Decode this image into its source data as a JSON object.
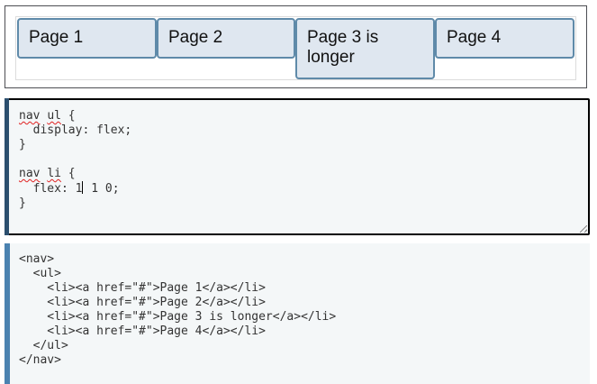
{
  "nav": {
    "items": [
      {
        "label": "Page 1",
        "href": "#"
      },
      {
        "label": "Page 2",
        "href": "#"
      },
      {
        "label": "Page 3 is longer",
        "href": "#"
      },
      {
        "label": "Page 4",
        "href": "#"
      }
    ]
  },
  "css_editor": {
    "rule1_selector_a": "nav",
    "rule1_selector_b": "ul",
    "rule1_open": " {",
    "rule1_decl": "  display: flex;",
    "rule1_close": "}",
    "rule2_selector_a": "nav",
    "rule2_selector_b": "li",
    "rule2_open": " {",
    "rule2_decl_before_caret": "  flex: 1",
    "rule2_decl_after_caret": " 1 0;",
    "rule2_close": "}"
  },
  "html_source": {
    "lines": [
      "<nav>",
      "  <ul>",
      "    <li><a href=\"#\">Page 1</a></li>",
      "    <li><a href=\"#\">Page 2</a></li>",
      "    <li><a href=\"#\">Page 3 is longer</a></li>",
      "    <li><a href=\"#\">Page 4</a></li>",
      "  </ul>",
      "</nav>"
    ]
  },
  "colors": {
    "nav_item_bg": "#dfe7f0",
    "nav_item_border": "#5f8aa9",
    "code_bg": "#f4f7f8",
    "editor_accent": "#2c4f6e",
    "html_accent": "#4b82b0",
    "spellcheck": "#e02020"
  }
}
